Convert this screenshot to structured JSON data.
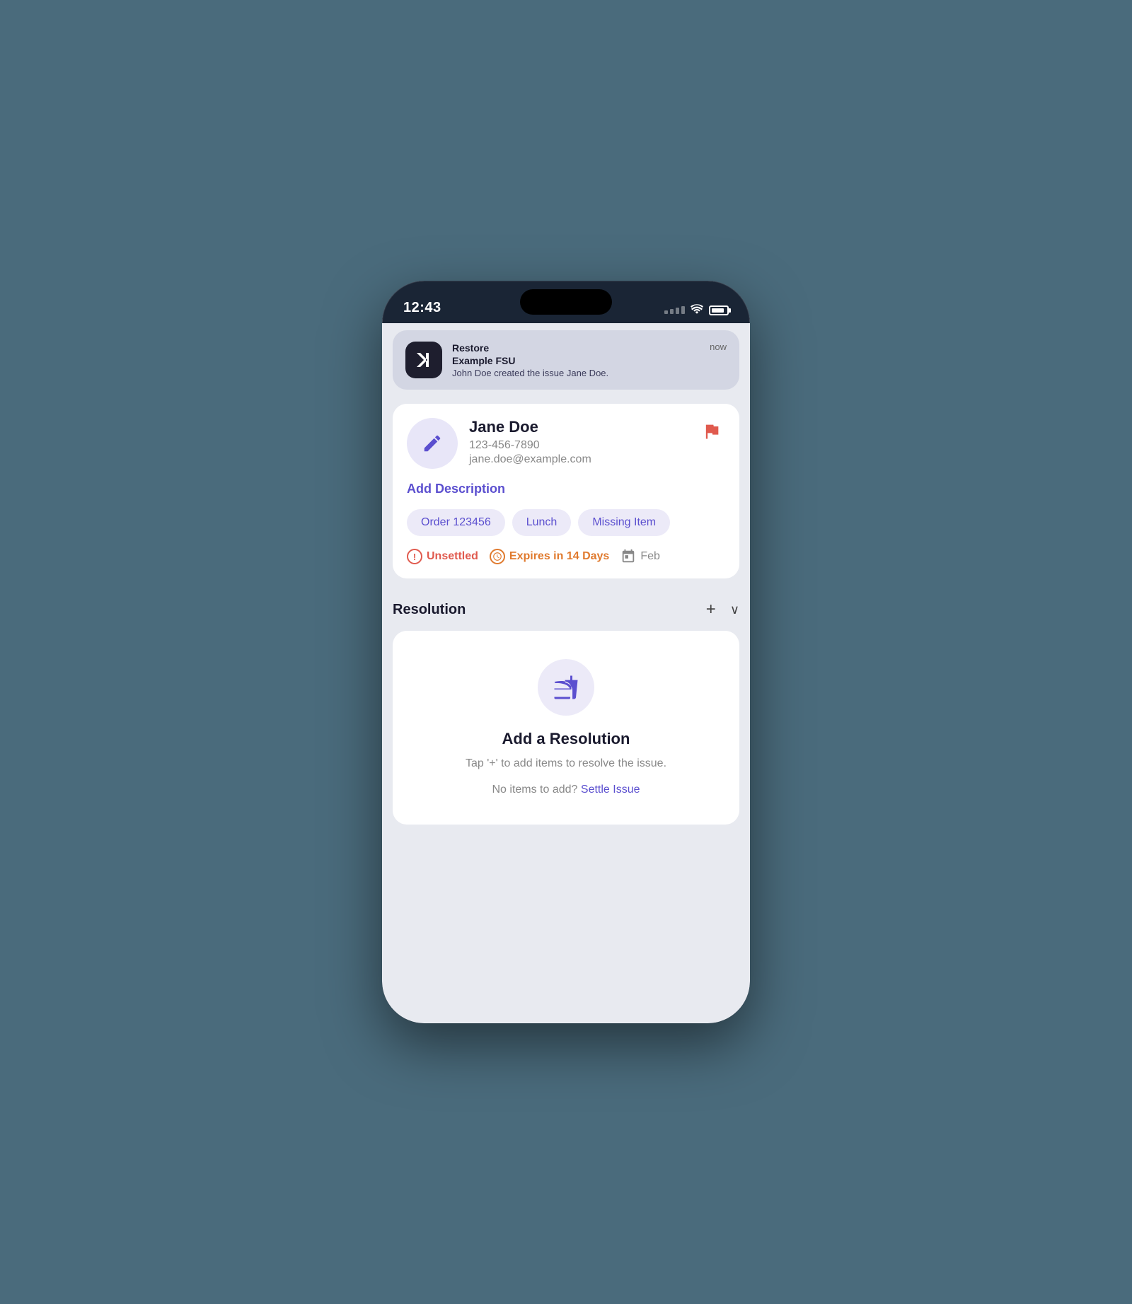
{
  "status_bar": {
    "time": "12:43",
    "battery_level": "85%"
  },
  "notification": {
    "app_name": "Restore",
    "sub_title": "Example FSU",
    "body": "John Doe created the issue Jane Doe.",
    "time": "now"
  },
  "issue": {
    "user_name": "Jane Doe",
    "user_phone": "123-456-7890",
    "user_email": "jane.doe@example.com",
    "add_description_label": "Add Description",
    "tags": [
      "Order 123456",
      "Lunch",
      "Missing Item"
    ],
    "status_unsettled": "Unsettled",
    "status_expires": "Expires in 14 Days",
    "status_date": "Feb"
  },
  "resolution": {
    "title": "Resolution",
    "add_btn": "+",
    "collapse_btn": "∨",
    "empty_title": "Add a Resolution",
    "empty_desc": "Tap '+' to add items to resolve the issue.",
    "settle_prefix": "No items to add?",
    "settle_link": "Settle Issue"
  }
}
